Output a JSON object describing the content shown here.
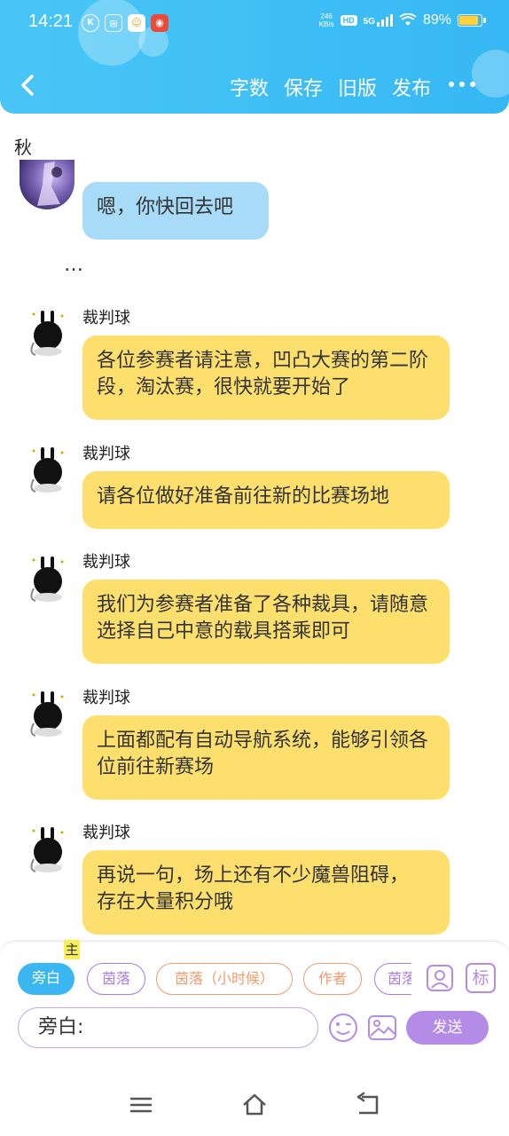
{
  "status_bar": {
    "time": "14:21",
    "net_speed_value": "246",
    "net_speed_unit": "KB/s",
    "hd": "HD",
    "network": "5G",
    "battery": "89%",
    "battery_level": 0.89
  },
  "header": {
    "actions": [
      "字数",
      "保存",
      "旧版",
      "发布"
    ]
  },
  "chat": {
    "partner_name": "秋",
    "messages": [
      {
        "sender": "",
        "text": "嗯，你快回去吧",
        "style": "blue"
      },
      {
        "sender": "",
        "text": "…",
        "style": "narration"
      },
      {
        "sender": "裁判球",
        "text": "各位参赛者请注意，凹凸大赛的第二阶段，淘汰赛，很快就要开始了",
        "style": "yellow"
      },
      {
        "sender": "裁判球",
        "text": "请各位做好准备前往新的比赛场地",
        "style": "yellow"
      },
      {
        "sender": "裁判球",
        "text": "我们为参赛者准备了各种裁具，请随意选择自己中意的载具搭乘即可",
        "style": "yellow"
      },
      {
        "sender": "裁判球",
        "text": "上面都配有自动导航系统，能够引领各位前往新赛场",
        "style": "yellow"
      },
      {
        "sender": "裁判球",
        "text": "再说一句，场上还有不少魔兽阻碍，存在大量积分哦",
        "style": "yellow"
      }
    ]
  },
  "composer": {
    "roles": [
      "旁白",
      "茵落",
      "茵落（小时候）",
      "作者",
      "茵落"
    ],
    "main_badge": "主",
    "tag_button": "标",
    "input_value": "旁白:",
    "send_label": "发送"
  },
  "colors": {
    "header": "#3ab8f4",
    "blue_bubble": "#a8dbf8",
    "yellow_bubble": "#fddf6e",
    "send": "#b48be6"
  }
}
